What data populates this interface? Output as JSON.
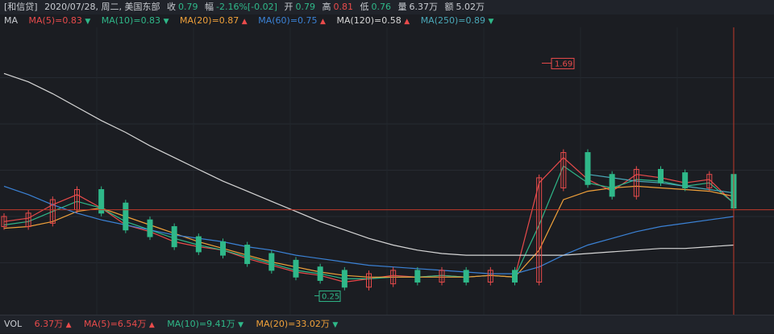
{
  "header": {
    "name": "[和信贷]",
    "date": "2020/07/28, 周二, 美国东部",
    "close_label": "收",
    "close": "0.79",
    "change_label": "幅",
    "change": "-2.16%[-0.02]",
    "open_label": "开",
    "open": "0.79",
    "high_label": "高",
    "high": "0.81",
    "low_label": "低",
    "low": "0.76",
    "volume_label": "量",
    "volume": "6.37万",
    "amount_label": "额",
    "amount": "5.02万"
  },
  "ma_legend": {
    "title": "MA",
    "items": [
      {
        "label": "MA(5)=0.83",
        "color": "#e94b4b",
        "arrow": "down"
      },
      {
        "label": "MA(10)=0.83",
        "color": "#2fb889",
        "arrow": "down"
      },
      {
        "label": "MA(20)=0.87",
        "color": "#f0a13a",
        "arrow": "up"
      },
      {
        "label": "MA(60)=0.75",
        "color": "#3b82d6",
        "arrow": "up"
      },
      {
        "label": "MA(120)=0.58",
        "color": "#d6d6d6",
        "arrow": "up"
      },
      {
        "label": "MA(250)=0.89",
        "color": "#4aa8b8",
        "arrow": "down"
      }
    ]
  },
  "vol_legend": {
    "title": "VOL",
    "value": "6.37万",
    "items": [
      {
        "label": "MA(5)=6.54万",
        "color": "#e94b4b",
        "arrow": "up"
      },
      {
        "label": "MA(10)=9.41万",
        "color": "#2fb889",
        "arrow": "down"
      },
      {
        "label": "MA(20)=33.02万",
        "color": "#f0a13a",
        "arrow": "down"
      }
    ]
  },
  "chart_data": {
    "type": "line",
    "colors": {
      "up": "#e94b4b",
      "down": "#2fb889",
      "crosshair": "#c0392b",
      "background": "#1b1d22"
    },
    "annotations": {
      "max_label": "1.69",
      "min_label": "0.25"
    },
    "x": [
      0,
      10,
      20,
      30,
      40,
      50,
      60,
      70,
      80,
      90,
      100,
      110,
      120,
      130,
      140,
      150,
      160,
      170,
      180,
      190,
      200,
      210,
      220,
      230,
      240,
      250,
      260,
      270,
      280,
      290,
      300
    ],
    "ylim": [
      0.2,
      1.85
    ],
    "series": [
      {
        "name": "MA(5)",
        "color": "#e94b4b",
        "values": [
          0.72,
          0.74,
          0.82,
          0.88,
          0.8,
          0.7,
          0.66,
          0.6,
          0.57,
          0.55,
          0.5,
          0.46,
          0.42,
          0.4,
          0.36,
          0.38,
          0.4,
          0.39,
          0.4,
          0.39,
          0.4,
          0.39,
          0.95,
          1.1,
          0.97,
          0.9,
          1.0,
          0.98,
          0.95,
          0.97,
          0.83
        ]
      },
      {
        "name": "MA(10)",
        "color": "#2fb889",
        "values": [
          0.7,
          0.72,
          0.78,
          0.84,
          0.8,
          0.72,
          0.67,
          0.62,
          0.58,
          0.55,
          0.51,
          0.47,
          0.43,
          0.41,
          0.38,
          0.38,
          0.39,
          0.39,
          0.4,
          0.39,
          0.4,
          0.39,
          0.7,
          1.05,
          0.95,
          0.92,
          0.97,
          0.96,
          0.93,
          0.95,
          0.83
        ]
      },
      {
        "name": "MA(20)",
        "color": "#f0a13a",
        "values": [
          0.68,
          0.69,
          0.72,
          0.78,
          0.8,
          0.75,
          0.7,
          0.65,
          0.6,
          0.56,
          0.52,
          0.48,
          0.45,
          0.42,
          0.4,
          0.39,
          0.39,
          0.39,
          0.39,
          0.39,
          0.4,
          0.39,
          0.55,
          0.85,
          0.9,
          0.92,
          0.93,
          0.92,
          0.91,
          0.9,
          0.87
        ]
      },
      {
        "name": "MA(60)",
        "color": "#3b82d6",
        "values": [
          0.93,
          0.88,
          0.82,
          0.77,
          0.73,
          0.7,
          0.67,
          0.64,
          0.62,
          0.6,
          0.57,
          0.55,
          0.52,
          0.5,
          0.48,
          0.46,
          0.45,
          0.44,
          0.43,
          0.42,
          0.41,
          0.41,
          0.45,
          0.52,
          0.58,
          0.62,
          0.66,
          0.69,
          0.71,
          0.73,
          0.75
        ]
      },
      {
        "name": "MA(120)",
        "color": "#d6d6d6",
        "values": [
          1.6,
          1.55,
          1.48,
          1.4,
          1.32,
          1.25,
          1.17,
          1.1,
          1.03,
          0.96,
          0.9,
          0.84,
          0.78,
          0.72,
          0.67,
          0.62,
          0.58,
          0.55,
          0.53,
          0.52,
          0.52,
          0.52,
          0.52,
          0.52,
          0.53,
          0.54,
          0.55,
          0.56,
          0.56,
          0.57,
          0.58
        ]
      },
      {
        "name": "MA(250)",
        "color": "#4aa8b8",
        "values": [
          null,
          null,
          null,
          null,
          null,
          null,
          null,
          null,
          null,
          null,
          null,
          null,
          null,
          null,
          null,
          null,
          null,
          null,
          null,
          null,
          null,
          null,
          null,
          null,
          1.0,
          0.98,
          0.96,
          0.95,
          0.93,
          0.91,
          0.89
        ]
      }
    ]
  }
}
